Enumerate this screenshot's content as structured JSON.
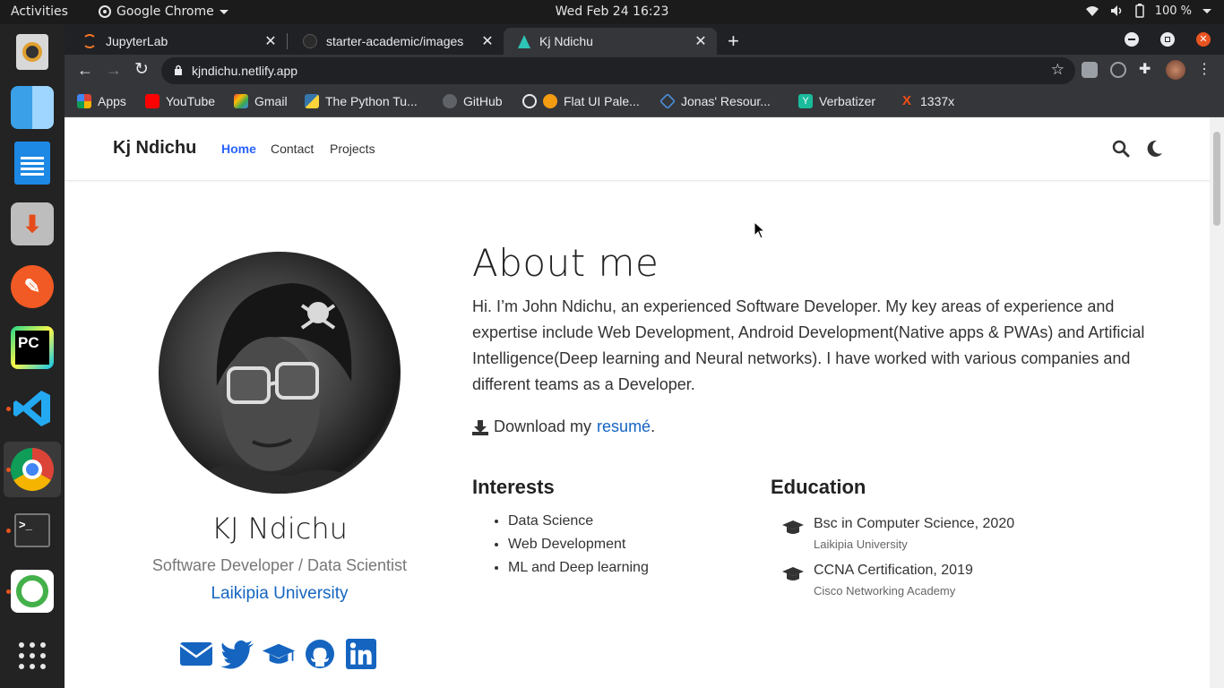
{
  "system_bar": {
    "activities": "Activities",
    "app_name": "Google Chrome",
    "clock": "Wed Feb 24  16:23",
    "battery": "100 %"
  },
  "dock": {
    "apps": [
      "rhythmbox-icon",
      "finder-icon",
      "writer-icon",
      "installer-icon",
      "postman-icon",
      "pycharm-icon",
      "vscode-icon",
      "chrome-icon",
      "terminal-icon",
      "anaconda-icon",
      "app-grid-icon"
    ]
  },
  "browser": {
    "tabs": [
      {
        "title": "JupyterLab"
      },
      {
        "title": "starter-academic/images"
      },
      {
        "title": "Kj Ndichu"
      }
    ],
    "url": "kjndichu.netlify.app",
    "bookmarks": [
      "Apps",
      "YouTube",
      "Gmail",
      "The Python Tu...",
      "GitHub",
      "Flat UI Pale...",
      "Jonas' Resour...",
      "Verbatizer",
      "1337x"
    ]
  },
  "site": {
    "brand": "Kj Ndichu",
    "nav": [
      "Home",
      "Contact",
      "Projects"
    ],
    "profile": {
      "name": "KJ Ndichu",
      "role": "Software Developer / Data Scientist",
      "organization": "Laikipia University"
    },
    "about": {
      "title": "About me",
      "bio": "Hi. I’m John Ndichu, an experienced Software Developer. My key areas of experience and expertise include Web Development, Android Development(Native apps & PWAs) and Artificial Intelligence(Deep learning and Neural networks). I have worked with various companies and different teams as a Developer.",
      "download_prefix": "Download my",
      "download_link": "resumé",
      "download_suffix": "."
    },
    "interests": {
      "title": "Interests",
      "items": [
        "Data Science",
        "Web Development",
        "ML and Deep learning"
      ]
    },
    "education": {
      "title": "Education",
      "items": [
        {
          "degree": "Bsc in Computer Science, 2020",
          "institution": "Laikipia University"
        },
        {
          "degree": "CCNA Certification, 2019",
          "institution": "Cisco Networking Academy"
        }
      ]
    }
  }
}
